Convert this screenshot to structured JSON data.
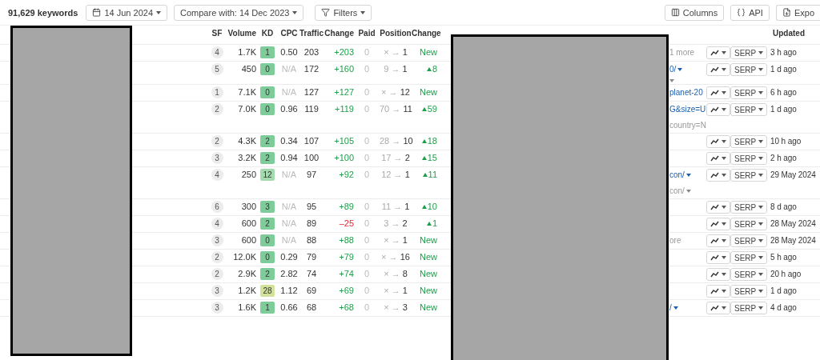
{
  "toolbar": {
    "count": "91,629 keywords",
    "date": "14 Jun 2024",
    "compare": "Compare with: 14 Dec 2023",
    "filters": "Filters",
    "columns": "Columns",
    "api": "API",
    "export": "Expo"
  },
  "table": {
    "columns": [
      "SF",
      "Volume",
      "KD",
      "CPC",
      "Traffic",
      "Change",
      "Paid",
      "Position",
      "Change",
      "Updated"
    ],
    "rows": [
      {
        "sf": "4",
        "volume": "1.7K",
        "kd": {
          "value": "1",
          "color": "#7fcc9b"
        },
        "cpc": {
          "value": "0.50",
          "na": false
        },
        "traffic": "203",
        "change": {
          "value": "+203",
          "kind": "up"
        },
        "paid": "0",
        "position": {
          "from": "×",
          "arrow": "→",
          "to": "1"
        },
        "pos_change": {
          "value": "New",
          "kind": "new"
        },
        "url": [
          {
            "text": "1 more",
            "kind": "plain",
            "caret": false
          }
        ],
        "serp": "SERP",
        "updated": "3 h ago"
      },
      {
        "sf": "5",
        "volume": "450",
        "kd": {
          "value": "0",
          "color": "#7fcc9b"
        },
        "cpc": {
          "value": "N/A",
          "na": true
        },
        "traffic": "172",
        "change": {
          "value": "+160",
          "kind": "up"
        },
        "paid": "0",
        "position": {
          "from": "9",
          "arrow": "→",
          "to": "1"
        },
        "pos_change": {
          "value": "8",
          "kind": "up"
        },
        "url": [
          {
            "text": "0/",
            "kind": "link",
            "caret": true
          },
          {
            "kind": "plain",
            "caret": true
          }
        ],
        "serp": "SERP",
        "updated": "1 d ago"
      },
      {
        "sf": "1",
        "volume": "7.1K",
        "kd": {
          "value": "0",
          "color": "#7fcc9b"
        },
        "cpc": {
          "value": "N/A",
          "na": true
        },
        "traffic": "127",
        "change": {
          "value": "+127",
          "kind": "up"
        },
        "paid": "0",
        "position": {
          "from": "×",
          "arrow": "→",
          "to": "12"
        },
        "pos_change": {
          "value": "New",
          "kind": "new"
        },
        "url": [
          {
            "text": "planet-20",
            "kind": "link",
            "caret": false
          }
        ],
        "serp": "SERP",
        "updated": "6 h ago"
      },
      {
        "sf": "2",
        "volume": "7.0K",
        "kd": {
          "value": "0",
          "color": "#7fcc9b"
        },
        "cpc": {
          "value": "0.96",
          "na": false
        },
        "traffic": "119",
        "change": {
          "value": "+119",
          "kind": "up"
        },
        "paid": "0",
        "position": {
          "from": "70",
          "arrow": "→",
          "to": "11"
        },
        "pos_change": {
          "value": "59",
          "kind": "up"
        },
        "url": [
          {
            "text": "G&size=U",
            "kind": "link",
            "caret": false
          },
          {
            "text": "country=N",
            "kind": "plain",
            "caret": false
          }
        ],
        "serp": "SERP",
        "updated": "1 d ago"
      },
      {
        "sf": "2",
        "volume": "4.3K",
        "kd": {
          "value": "2",
          "color": "#7fcc9b"
        },
        "cpc": {
          "value": "0.34",
          "na": false
        },
        "traffic": "107",
        "change": {
          "value": "+105",
          "kind": "up"
        },
        "paid": "0",
        "position": {
          "from": "28",
          "arrow": "→",
          "to": "10"
        },
        "pos_change": {
          "value": "18",
          "kind": "up"
        },
        "url": [],
        "serp": "SERP",
        "updated": "10 h ago"
      },
      {
        "sf": "3",
        "volume": "3.2K",
        "kd": {
          "value": "2",
          "color": "#7fcc9b"
        },
        "cpc": {
          "value": "0.94",
          "na": false
        },
        "traffic": "100",
        "change": {
          "value": "+100",
          "kind": "up"
        },
        "paid": "0",
        "position": {
          "from": "17",
          "arrow": "→",
          "to": "2"
        },
        "pos_change": {
          "value": "15",
          "kind": "up"
        },
        "url": [],
        "serp": "SERP",
        "updated": "2 h ago"
      },
      {
        "sf": "4",
        "volume": "250",
        "kd": {
          "value": "12",
          "color": "#a3dbae"
        },
        "cpc": {
          "value": "N/A",
          "na": true
        },
        "traffic": "97",
        "change": {
          "value": "+92",
          "kind": "up"
        },
        "paid": "0",
        "position": {
          "from": "12",
          "arrow": "→",
          "to": "1"
        },
        "pos_change": {
          "value": "11",
          "kind": "up"
        },
        "url": [
          {
            "text": "con/",
            "kind": "link",
            "caret": true
          },
          {
            "text": "con/",
            "kind": "plain",
            "caret": true
          }
        ],
        "serp": "SERP",
        "updated": "29 May 2024"
      },
      {
        "sf": "6",
        "volume": "300",
        "kd": {
          "value": "3",
          "color": "#7fcc9b"
        },
        "cpc": {
          "value": "N/A",
          "na": true
        },
        "traffic": "95",
        "change": {
          "value": "+89",
          "kind": "up"
        },
        "paid": "0",
        "position": {
          "from": "11",
          "arrow": "→",
          "to": "1"
        },
        "pos_change": {
          "value": "10",
          "kind": "up"
        },
        "url": [],
        "serp": "SERP",
        "updated": "8 d ago"
      },
      {
        "sf": "4",
        "volume": "600",
        "kd": {
          "value": "2",
          "color": "#7fcc9b"
        },
        "cpc": {
          "value": "N/A",
          "na": true
        },
        "traffic": "89",
        "change": {
          "value": "–25",
          "kind": "down"
        },
        "paid": "0",
        "position": {
          "from": "3",
          "arrow": "→",
          "to": "2"
        },
        "pos_change": {
          "value": "1",
          "kind": "up"
        },
        "url": [],
        "serp": "SERP",
        "updated": "28 May 2024"
      },
      {
        "sf": "3",
        "volume": "600",
        "kd": {
          "value": "0",
          "color": "#7fcc9b"
        },
        "cpc": {
          "value": "N/A",
          "na": true
        },
        "traffic": "88",
        "change": {
          "value": "+88",
          "kind": "up"
        },
        "paid": "0",
        "position": {
          "from": "×",
          "arrow": "→",
          "to": "1"
        },
        "pos_change": {
          "value": "New",
          "kind": "new"
        },
        "url": [
          {
            "text": "ore",
            "kind": "plain",
            "caret": false
          }
        ],
        "serp": "SERP",
        "updated": "28 May 2024"
      },
      {
        "sf": "2",
        "volume": "12.0K",
        "kd": {
          "value": "0",
          "color": "#7fcc9b"
        },
        "cpc": {
          "value": "0.29",
          "na": false
        },
        "traffic": "79",
        "change": {
          "value": "+79",
          "kind": "up"
        },
        "paid": "0",
        "position": {
          "from": "×",
          "arrow": "→",
          "to": "16"
        },
        "pos_change": {
          "value": "New",
          "kind": "new"
        },
        "url": [],
        "serp": "SERP",
        "updated": "5 h ago"
      },
      {
        "sf": "2",
        "volume": "2.9K",
        "kd": {
          "value": "2",
          "color": "#7fcc9b"
        },
        "cpc": {
          "value": "2.82",
          "na": false
        },
        "traffic": "74",
        "change": {
          "value": "+74",
          "kind": "up"
        },
        "paid": "0",
        "position": {
          "from": "×",
          "arrow": "→",
          "to": "8"
        },
        "pos_change": {
          "value": "New",
          "kind": "new"
        },
        "url": [],
        "serp": "SERP",
        "updated": "20 h ago"
      },
      {
        "sf": "3",
        "volume": "1.2K",
        "kd": {
          "value": "28",
          "color": "#d2e29a"
        },
        "cpc": {
          "value": "1.12",
          "na": false
        },
        "traffic": "69",
        "change": {
          "value": "+69",
          "kind": "up"
        },
        "paid": "0",
        "position": {
          "from": "×",
          "arrow": "→",
          "to": "1"
        },
        "pos_change": {
          "value": "New",
          "kind": "new"
        },
        "url": [],
        "serp": "SERP",
        "updated": "1 d ago"
      },
      {
        "sf": "3",
        "volume": "1.6K",
        "kd": {
          "value": "1",
          "color": "#7fcc9b"
        },
        "cpc": {
          "value": "0.66",
          "na": false
        },
        "traffic": "68",
        "change": {
          "value": "+68",
          "kind": "up"
        },
        "paid": "0",
        "position": {
          "from": "×",
          "arrow": "→",
          "to": "3"
        },
        "pos_change": {
          "value": "New",
          "kind": "new"
        },
        "url": [
          {
            "text": "/",
            "kind": "link",
            "caret": true
          }
        ],
        "serp": "SERP",
        "updated": "4 d ago"
      }
    ]
  }
}
